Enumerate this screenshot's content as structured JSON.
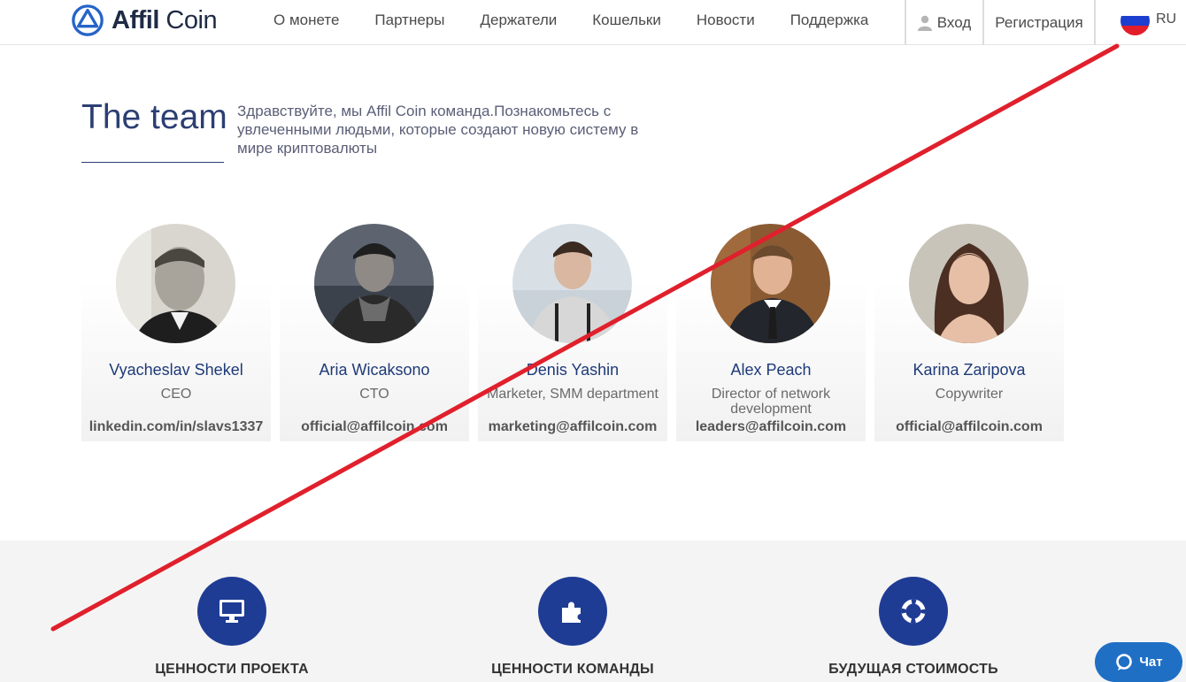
{
  "brand": {
    "name_bold": "Affil",
    "name_rest": " Coin",
    "accent": "#1f3c94"
  },
  "nav": {
    "items": [
      "О монете",
      "Партнеры",
      "Держатели",
      "Кошельки",
      "Новости",
      "Поддержка"
    ]
  },
  "auth": {
    "login": "Вход",
    "register": "Регистрация"
  },
  "language": {
    "code": "RU"
  },
  "team": {
    "title": "The team",
    "description": "Здравствуйте, мы Affil Coin команда.Познакомьтесь с увлеченными людьми, которые создают новую систему в мире криптовалюты",
    "members": [
      {
        "name": "Vyacheslav Shekel",
        "role": "CEO",
        "contact": "linkedin.com/in/slavs1337"
      },
      {
        "name": "Aria Wicaksono",
        "role": "CTO",
        "contact": "official@affilcoin.com"
      },
      {
        "name": "Denis Yashin",
        "role": "Marketer, SMM department",
        "contact": "marketing@affilcoin.com"
      },
      {
        "name": "Alex Peach",
        "role": "Director of network development",
        "contact": "leaders@affilcoin.com"
      },
      {
        "name": "Karina Zaripova",
        "role": "Copywriter",
        "contact": "official@affilcoin.com"
      }
    ]
  },
  "values": {
    "items": [
      {
        "label": "ЦЕННОСТИ ПРОЕКТА",
        "icon": "monitor-icon"
      },
      {
        "label": "ЦЕННОСТИ КОМАНДЫ",
        "icon": "puzzle-icon"
      },
      {
        "label": "БУДУЩАЯ СТОИМОСТЬ",
        "icon": "lifebuoy-icon"
      }
    ]
  },
  "chat": {
    "label": "Чат"
  }
}
